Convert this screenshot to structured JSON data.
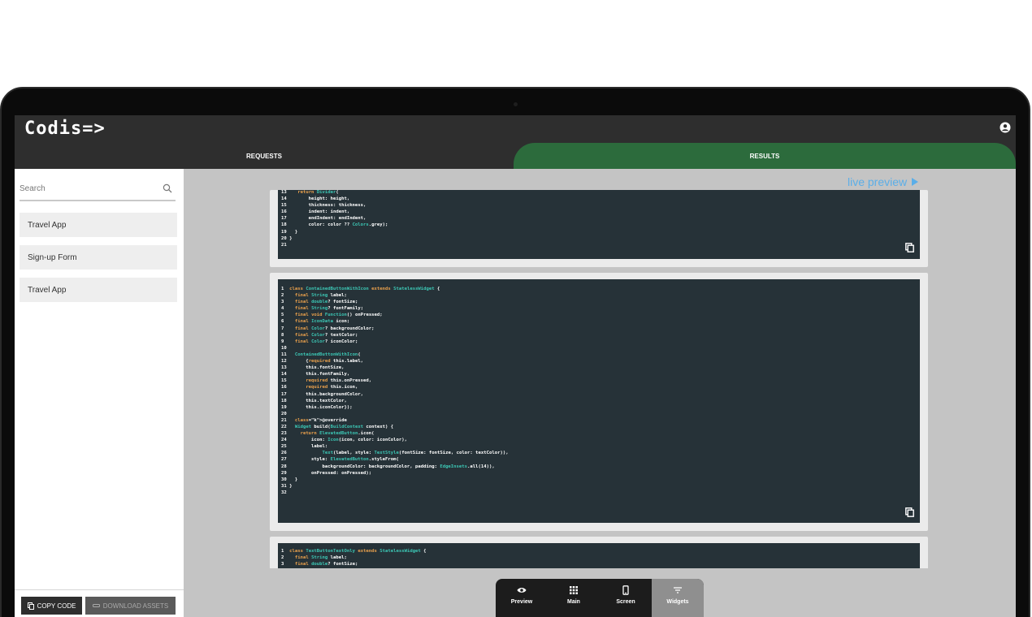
{
  "app": {
    "logo": "Codis=>"
  },
  "tabs": {
    "requests": "REQUESTS",
    "results": "RESULTS"
  },
  "search": {
    "placeholder": "Search"
  },
  "projects": [
    "Travel App",
    "Sign-up Form",
    "Travel App"
  ],
  "actions": {
    "copy_code": "COPY CODE",
    "download_assets": "DOWNLOAD ASSETS"
  },
  "live_preview": "live preview",
  "nav": {
    "preview": "Preview",
    "main": "Main",
    "screen": "Screen",
    "widgets": "Widgets"
  },
  "code_blocks": [
    [
      "13    return Divider(",
      "14        height: height,",
      "15        thickness: thickness,",
      "16        indent: indent,",
      "17        endIndent: endIndent,",
      "18        color: color ?? Colors.grey);",
      "19   }",
      "20 }",
      "21"
    ],
    [
      "1  class ContainedButtonWithIcon extends StatelessWidget {",
      "2    final String label;",
      "3    final double? fontSize;",
      "4    final String? fontFamily;",
      "5    final void Function() onPressed;",
      "6    final IconData icon;",
      "7    final Color? backgroundColor;",
      "8    final Color? textColor;",
      "9    final Color? iconColor;",
      "10",
      "11   ContainedButtonWithIcon(",
      "12       {required this.label,",
      "13       this.fontSize,",
      "14       this.fontFamily,",
      "15       required this.onPressed,",
      "16       required this.icon,",
      "17       this.backgroundColor,",
      "18       this.textColor,",
      "19       this.iconColor});",
      "20",
      "21   @override",
      "22   Widget build(BuildContext context) {",
      "23     return ElevatedButton.icon(",
      "24         icon: Icon(icon, color: iconColor),",
      "25         label:",
      "26             Text(label, style: TextStyle(fontSize: fontSize, color: textColor)),",
      "27         style: ElevatedButton.styleFrom(",
      "28             backgroundColor: backgroundColor, padding: EdgeInsets.all(14)),",
      "29         onPressed: onPressed);",
      "30   }",
      "31 }",
      "32"
    ],
    [
      "1  class TextButtonTextOnly extends StatelessWidget {",
      "2    final String label;",
      "3    final double? fontSize;"
    ]
  ],
  "colors": {
    "topbar": "#2e2e2e",
    "results_tab": "#2c6b3c",
    "code_bg": "#263238",
    "keyword": "#e9a04c",
    "type": "#3cc7b5",
    "live_preview": "#5aaee8",
    "widgets_active": "#8f8f8f"
  },
  "icons": {
    "user": "user-circle-icon",
    "search": "search-icon",
    "copy": "copy-icon",
    "download": "download-icon",
    "play": "play-icon",
    "preview": "eye-icon",
    "main": "grid-icon",
    "screen": "phone-icon",
    "widgets": "filter-icon"
  }
}
